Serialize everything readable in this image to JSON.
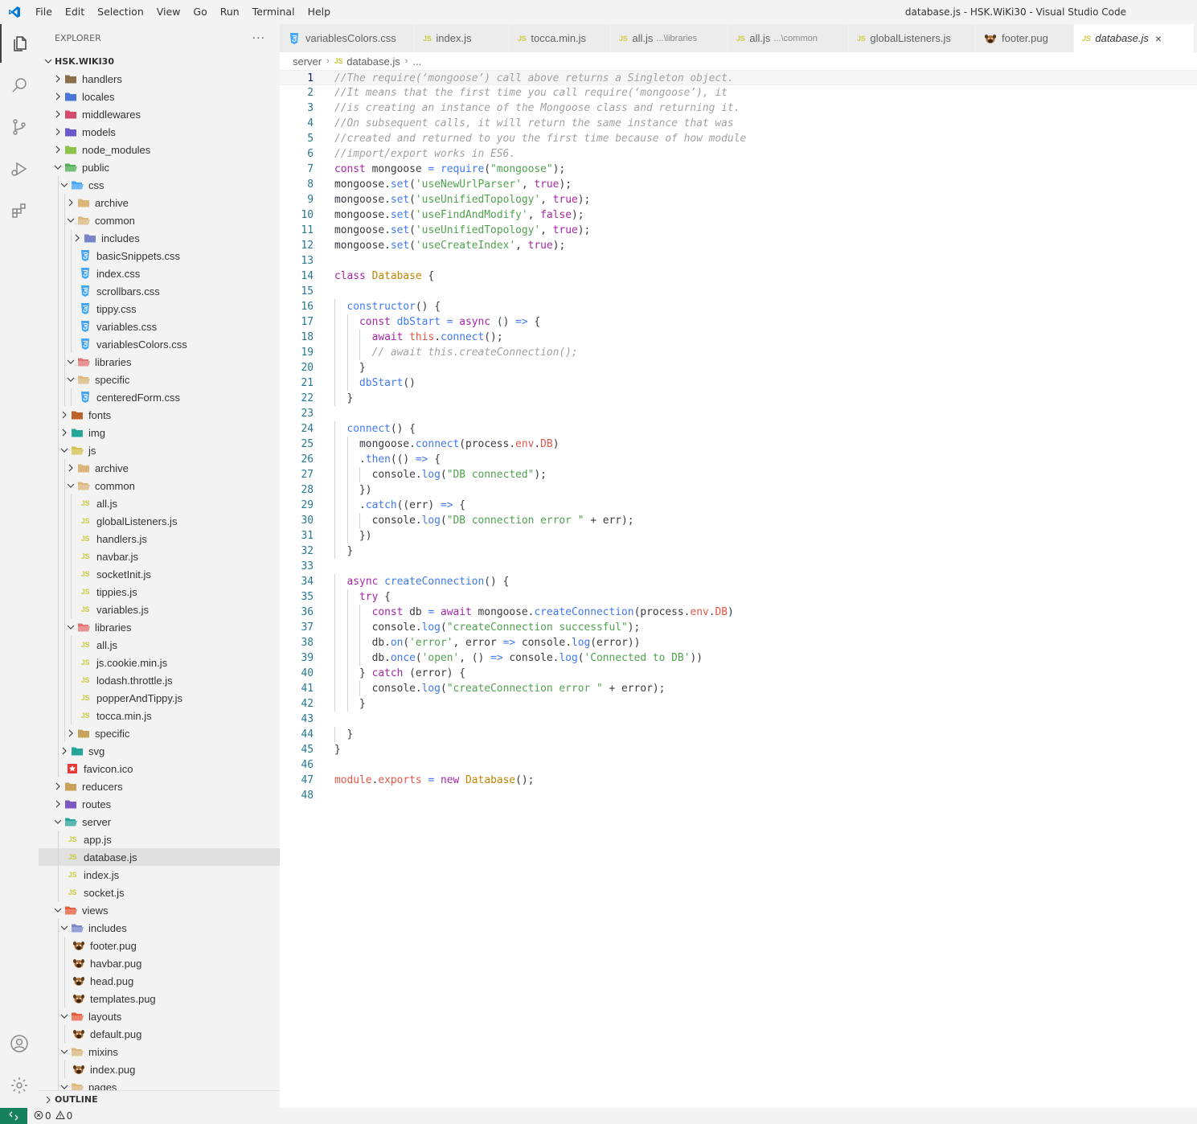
{
  "window": {
    "title": "database.js - HSK.WiKi30 - Visual Studio Code"
  },
  "menu": [
    "File",
    "Edit",
    "Selection",
    "View",
    "Go",
    "Run",
    "Terminal",
    "Help"
  ],
  "sidebar": {
    "title": "EXPLORER",
    "more": "···",
    "root": "HSK.WIKI30",
    "outline": "OUTLINE",
    "tree": [
      {
        "label": "handlers",
        "depth": 0,
        "type": "folder",
        "open": false,
        "color": "#8a6e4b"
      },
      {
        "label": "locales",
        "depth": 0,
        "type": "folder",
        "open": false,
        "color": "#4a78d6"
      },
      {
        "label": "middlewares",
        "depth": 0,
        "type": "folder",
        "open": false,
        "color": "#d64a6e"
      },
      {
        "label": "models",
        "depth": 0,
        "type": "folder",
        "open": false,
        "color": "#6a5acd"
      },
      {
        "label": "node_modules",
        "depth": 0,
        "type": "folder",
        "open": false,
        "color": "#8bc34a"
      },
      {
        "label": "public",
        "depth": 0,
        "type": "folder",
        "open": true,
        "color": "#4caf50"
      },
      {
        "label": "css",
        "depth": 1,
        "type": "folder",
        "open": true,
        "color": "#42a5f5"
      },
      {
        "label": "archive",
        "depth": 2,
        "type": "folder",
        "open": false,
        "color": "#dcb67a"
      },
      {
        "label": "common",
        "depth": 2,
        "type": "folder",
        "open": true,
        "color": "#dcb67a"
      },
      {
        "label": "includes",
        "depth": 3,
        "type": "folder",
        "open": false,
        "color": "#7986cb"
      },
      {
        "label": "basicSnippets.css",
        "depth": 3,
        "type": "css"
      },
      {
        "label": "index.css",
        "depth": 3,
        "type": "css"
      },
      {
        "label": "scrollbars.css",
        "depth": 3,
        "type": "css"
      },
      {
        "label": "tippy.css",
        "depth": 3,
        "type": "css"
      },
      {
        "label": "variables.css",
        "depth": 3,
        "type": "css"
      },
      {
        "label": "variablesColors.css",
        "depth": 3,
        "type": "css"
      },
      {
        "label": "libraries",
        "depth": 2,
        "type": "folder",
        "open": true,
        "color": "#e57373"
      },
      {
        "label": "specific",
        "depth": 2,
        "type": "folder",
        "open": true,
        "color": "#dcb67a"
      },
      {
        "label": "centeredForm.css",
        "depth": 3,
        "type": "css"
      },
      {
        "label": "fonts",
        "depth": 1,
        "type": "folder",
        "open": false,
        "color": "#c0602a"
      },
      {
        "label": "img",
        "depth": 1,
        "type": "folder",
        "open": false,
        "color": "#26a69a"
      },
      {
        "label": "js",
        "depth": 1,
        "type": "folder",
        "open": true,
        "color": "#d4c24a"
      },
      {
        "label": "archive",
        "depth": 2,
        "type": "folder",
        "open": false,
        "color": "#dcb67a"
      },
      {
        "label": "common",
        "depth": 2,
        "type": "folder",
        "open": true,
        "color": "#dcb67a"
      },
      {
        "label": "all.js",
        "depth": 3,
        "type": "js"
      },
      {
        "label": "globalListeners.js",
        "depth": 3,
        "type": "js"
      },
      {
        "label": "handlers.js",
        "depth": 3,
        "type": "js"
      },
      {
        "label": "navbar.js",
        "depth": 3,
        "type": "js"
      },
      {
        "label": "socketInit.js",
        "depth": 3,
        "type": "js"
      },
      {
        "label": "tippies.js",
        "depth": 3,
        "type": "js"
      },
      {
        "label": "variables.js",
        "depth": 3,
        "type": "js"
      },
      {
        "label": "libraries",
        "depth": 2,
        "type": "folder",
        "open": true,
        "color": "#e57373"
      },
      {
        "label": "all.js",
        "depth": 3,
        "type": "js"
      },
      {
        "label": "js.cookie.min.js",
        "depth": 3,
        "type": "js"
      },
      {
        "label": "lodash.throttle.js",
        "depth": 3,
        "type": "js"
      },
      {
        "label": "popperAndTippy.js",
        "depth": 3,
        "type": "js"
      },
      {
        "label": "tocca.min.js",
        "depth": 3,
        "type": "js"
      },
      {
        "label": "specific",
        "depth": 2,
        "type": "folder",
        "open": false,
        "color": "#c9a15a"
      },
      {
        "label": "svg",
        "depth": 1,
        "type": "folder",
        "open": false,
        "color": "#26a69a"
      },
      {
        "label": "favicon.ico",
        "depth": 1,
        "type": "ico"
      },
      {
        "label": "reducers",
        "depth": 0,
        "type": "folder",
        "open": false,
        "color": "#c9a15a"
      },
      {
        "label": "routes",
        "depth": 0,
        "type": "folder",
        "open": false,
        "color": "#7e57c2"
      },
      {
        "label": "server",
        "depth": 0,
        "type": "folder",
        "open": true,
        "color": "#26a69a"
      },
      {
        "label": "app.js",
        "depth": 1,
        "type": "js"
      },
      {
        "label": "database.js",
        "depth": 1,
        "type": "js",
        "active": true
      },
      {
        "label": "index.js",
        "depth": 1,
        "type": "js"
      },
      {
        "label": "socket.js",
        "depth": 1,
        "type": "js"
      },
      {
        "label": "views",
        "depth": 0,
        "type": "folder",
        "open": true,
        "color": "#e65c3a"
      },
      {
        "label": "includes",
        "depth": 1,
        "type": "folder",
        "open": true,
        "color": "#7986cb"
      },
      {
        "label": "footer.pug",
        "depth": 2,
        "type": "pug"
      },
      {
        "label": "havbar.pug",
        "depth": 2,
        "type": "pug"
      },
      {
        "label": "head.pug",
        "depth": 2,
        "type": "pug"
      },
      {
        "label": "templates.pug",
        "depth": 2,
        "type": "pug"
      },
      {
        "label": "layouts",
        "depth": 1,
        "type": "folder",
        "open": true,
        "color": "#e65c3a"
      },
      {
        "label": "default.pug",
        "depth": 2,
        "type": "pug"
      },
      {
        "label": "mixins",
        "depth": 1,
        "type": "folder",
        "open": true,
        "color": "#dcb67a"
      },
      {
        "label": "index.pug",
        "depth": 2,
        "type": "pug"
      },
      {
        "label": "pages",
        "depth": 1,
        "type": "folder",
        "open": true,
        "color": "#dcb67a"
      }
    ]
  },
  "tabs": [
    {
      "label": "variablesColors.css",
      "type": "css",
      "desc": ""
    },
    {
      "label": "index.js",
      "type": "js",
      "desc": ""
    },
    {
      "label": "tocca.min.js",
      "type": "js",
      "desc": ""
    },
    {
      "label": "all.js",
      "type": "js",
      "desc": "...\\libraries"
    },
    {
      "label": "all.js",
      "type": "js",
      "desc": "...\\common"
    },
    {
      "label": "globalListeners.js",
      "type": "js",
      "desc": ""
    },
    {
      "label": "footer.pug",
      "type": "pug",
      "desc": ""
    },
    {
      "label": "database.js",
      "type": "js",
      "desc": "",
      "active": true
    }
  ],
  "breadcrumb": {
    "folder": "server",
    "file": "database.js",
    "more": "..."
  },
  "icons": {
    "js": "JS",
    "close": "×",
    "logo": "vscode-logo-icon",
    "activity": [
      "explorer-icon",
      "search-icon",
      "source-control-icon",
      "run-debug-icon",
      "extensions-icon",
      "account-icon",
      "settings-gear-icon"
    ]
  },
  "colors": {
    "comment": "#a0a1a7",
    "keyword": "#a626a4",
    "string": "#50a14f",
    "func": "#4078f2",
    "classname": "#c18401",
    "prop": "#e45649",
    "text": "#383a42",
    "accent": "#16825d"
  },
  "editor": {
    "current_line": 1,
    "lines": [
      [
        [
          "//The require(‘mongoose’) call above returns a Singleton object.",
          "comment"
        ]
      ],
      [
        [
          "//It means that the first time you call require(‘mongoose’), it",
          "comment"
        ]
      ],
      [
        [
          "//is creating an instance of the Mongoose class and returning it.",
          "comment"
        ]
      ],
      [
        [
          "//On subsequent calls, it will return the same instance that was",
          "comment"
        ]
      ],
      [
        [
          "//created and returned to you the first time because of how module",
          "comment"
        ]
      ],
      [
        [
          "//import/export works in ES6.",
          "comment"
        ]
      ],
      [
        [
          "const",
          "keyword"
        ],
        [
          " mongoose ",
          "text"
        ],
        [
          "=",
          "op"
        ],
        [
          " ",
          "text"
        ],
        [
          "require",
          "func"
        ],
        [
          "(",
          "text"
        ],
        [
          "\"mongoose\"",
          "string"
        ],
        [
          ");",
          "text"
        ]
      ],
      [
        [
          "mongoose.",
          "text"
        ],
        [
          "set",
          "func"
        ],
        [
          "(",
          "text"
        ],
        [
          "'useNewUrlParser'",
          "string"
        ],
        [
          ", ",
          "text"
        ],
        [
          "true",
          "keyword"
        ],
        [
          ");",
          "text"
        ]
      ],
      [
        [
          "mongoose.",
          "text"
        ],
        [
          "set",
          "func"
        ],
        [
          "(",
          "text"
        ],
        [
          "'useUnifiedTopology'",
          "string"
        ],
        [
          ", ",
          "text"
        ],
        [
          "true",
          "keyword"
        ],
        [
          ");",
          "text"
        ]
      ],
      [
        [
          "mongoose.",
          "text"
        ],
        [
          "set",
          "func"
        ],
        [
          "(",
          "text"
        ],
        [
          "'useFindAndModify'",
          "string"
        ],
        [
          ", ",
          "text"
        ],
        [
          "false",
          "keyword"
        ],
        [
          ");",
          "text"
        ]
      ],
      [
        [
          "mongoose.",
          "text"
        ],
        [
          "set",
          "func"
        ],
        [
          "(",
          "text"
        ],
        [
          "'useUnifiedTopology'",
          "string"
        ],
        [
          ", ",
          "text"
        ],
        [
          "true",
          "keyword"
        ],
        [
          ");",
          "text"
        ]
      ],
      [
        [
          "mongoose.",
          "text"
        ],
        [
          "set",
          "func"
        ],
        [
          "(",
          "text"
        ],
        [
          "'useCreateIndex'",
          "string"
        ],
        [
          ", ",
          "text"
        ],
        [
          "true",
          "keyword"
        ],
        [
          ");",
          "text"
        ]
      ],
      [],
      [
        [
          "class",
          "keyword"
        ],
        [
          " ",
          "text"
        ],
        [
          "Database",
          "classname"
        ],
        [
          " {",
          "text"
        ]
      ],
      [],
      [
        [
          "  ",
          "text"
        ],
        [
          "constructor",
          "func"
        ],
        [
          "() {",
          "text"
        ]
      ],
      [
        [
          "    ",
          "text"
        ],
        [
          "const",
          "keyword"
        ],
        [
          " ",
          "text"
        ],
        [
          "dbStart",
          "func"
        ],
        [
          " ",
          "text"
        ],
        [
          "=",
          "op"
        ],
        [
          " ",
          "text"
        ],
        [
          "async",
          "keyword"
        ],
        [
          " () ",
          "text"
        ],
        [
          "=>",
          "op"
        ],
        [
          " {",
          "text"
        ]
      ],
      [
        [
          "      ",
          "text"
        ],
        [
          "await",
          "keyword"
        ],
        [
          " ",
          "text"
        ],
        [
          "this",
          "prop"
        ],
        [
          ".",
          "text"
        ],
        [
          "connect",
          "func"
        ],
        [
          "();",
          "text"
        ]
      ],
      [
        [
          "      ",
          "text"
        ],
        [
          "// await this.createConnection();",
          "comment"
        ]
      ],
      [
        [
          "    }",
          "text"
        ]
      ],
      [
        [
          "    ",
          "text"
        ],
        [
          "dbStart",
          "func"
        ],
        [
          "()",
          "text"
        ]
      ],
      [
        [
          "  }",
          "text"
        ]
      ],
      [],
      [
        [
          "  ",
          "text"
        ],
        [
          "connect",
          "func"
        ],
        [
          "() {",
          "text"
        ]
      ],
      [
        [
          "    mongoose.",
          "text"
        ],
        [
          "connect",
          "func"
        ],
        [
          "(process.",
          "text"
        ],
        [
          "env",
          "prop"
        ],
        [
          ".",
          "text"
        ],
        [
          "DB",
          "prop"
        ],
        [
          ")",
          "text"
        ]
      ],
      [
        [
          "    .",
          "text"
        ],
        [
          "then",
          "func"
        ],
        [
          "(() ",
          "text"
        ],
        [
          "=>",
          "op"
        ],
        [
          " {",
          "text"
        ]
      ],
      [
        [
          "      console.",
          "text"
        ],
        [
          "log",
          "func"
        ],
        [
          "(",
          "text"
        ],
        [
          "\"DB connected\"",
          "string"
        ],
        [
          ");",
          "text"
        ]
      ],
      [
        [
          "    })",
          "text"
        ]
      ],
      [
        [
          "    .",
          "text"
        ],
        [
          "catch",
          "func"
        ],
        [
          "((err) ",
          "text"
        ],
        [
          "=>",
          "op"
        ],
        [
          " {",
          "text"
        ]
      ],
      [
        [
          "      console.",
          "text"
        ],
        [
          "log",
          "func"
        ],
        [
          "(",
          "text"
        ],
        [
          "\"DB connection error \"",
          "string"
        ],
        [
          " + err);",
          "text"
        ]
      ],
      [
        [
          "    })",
          "text"
        ]
      ],
      [
        [
          "  }",
          "text"
        ]
      ],
      [],
      [
        [
          "  ",
          "text"
        ],
        [
          "async",
          "keyword"
        ],
        [
          " ",
          "text"
        ],
        [
          "createConnection",
          "func"
        ],
        [
          "() {",
          "text"
        ]
      ],
      [
        [
          "    ",
          "text"
        ],
        [
          "try",
          "keyword"
        ],
        [
          " {",
          "text"
        ]
      ],
      [
        [
          "      ",
          "text"
        ],
        [
          "const",
          "keyword"
        ],
        [
          " db ",
          "text"
        ],
        [
          "=",
          "op"
        ],
        [
          " ",
          "text"
        ],
        [
          "await",
          "keyword"
        ],
        [
          " mongoose.",
          "text"
        ],
        [
          "createConnection",
          "func"
        ],
        [
          "(process.",
          "text"
        ],
        [
          "env",
          "prop"
        ],
        [
          ".",
          "text"
        ],
        [
          "DB",
          "prop"
        ],
        [
          ")",
          "text"
        ]
      ],
      [
        [
          "      console.",
          "text"
        ],
        [
          "log",
          "func"
        ],
        [
          "(",
          "text"
        ],
        [
          "\"createConnection successful\"",
          "string"
        ],
        [
          ");",
          "text"
        ]
      ],
      [
        [
          "      db.",
          "text"
        ],
        [
          "on",
          "func"
        ],
        [
          "(",
          "text"
        ],
        [
          "'error'",
          "string"
        ],
        [
          ", error ",
          "text"
        ],
        [
          "=>",
          "op"
        ],
        [
          " console.",
          "text"
        ],
        [
          "log",
          "func"
        ],
        [
          "(error))",
          "text"
        ]
      ],
      [
        [
          "      db.",
          "text"
        ],
        [
          "once",
          "func"
        ],
        [
          "(",
          "text"
        ],
        [
          "'open'",
          "string"
        ],
        [
          ", () ",
          "text"
        ],
        [
          "=>",
          "op"
        ],
        [
          " console.",
          "text"
        ],
        [
          "log",
          "func"
        ],
        [
          "(",
          "text"
        ],
        [
          "'Connected to DB'",
          "string"
        ],
        [
          "))",
          "text"
        ]
      ],
      [
        [
          "    } ",
          "text"
        ],
        [
          "catch",
          "keyword"
        ],
        [
          " (error) {",
          "text"
        ]
      ],
      [
        [
          "      console.",
          "text"
        ],
        [
          "log",
          "func"
        ],
        [
          "(",
          "text"
        ],
        [
          "\"createConnection error \"",
          "string"
        ],
        [
          " + error);",
          "text"
        ]
      ],
      [
        [
          "    }",
          "text"
        ]
      ],
      [],
      [
        [
          "  }",
          "text"
        ]
      ],
      [
        [
          "}",
          "text"
        ]
      ],
      [],
      [
        [
          "module",
          "prop"
        ],
        [
          ".",
          "text"
        ],
        [
          "exports",
          "prop"
        ],
        [
          " ",
          "text"
        ],
        [
          "=",
          "op"
        ],
        [
          " ",
          "text"
        ],
        [
          "new",
          "keyword"
        ],
        [
          " ",
          "text"
        ],
        [
          "Database",
          "classname"
        ],
        [
          "();",
          "text"
        ]
      ],
      []
    ]
  },
  "status": {
    "errors": "0",
    "warnings": "0"
  }
}
